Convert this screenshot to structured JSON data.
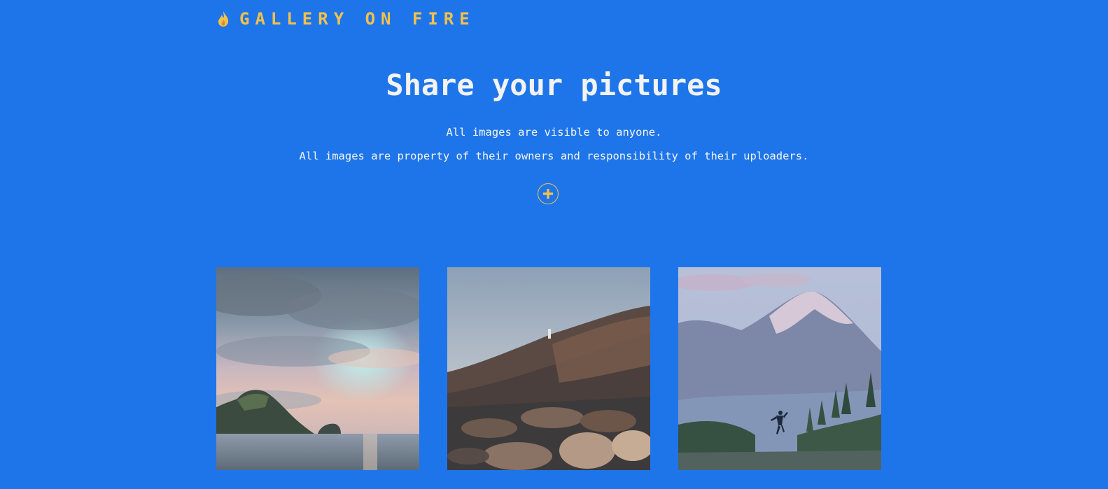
{
  "header": {
    "brand_icon": "flame-icon",
    "brand_name": "GALLERY ON FIRE"
  },
  "hero": {
    "title": "Share your pictures",
    "line1": "All images are visible to anyone.",
    "line2": "All images are property of their owners and responsibility of their uploaders."
  },
  "upload": {
    "icon": "plus-icon"
  },
  "colors": {
    "background": "#1e75ea",
    "accent": "#f2c14b",
    "text": "#f3f3f3"
  },
  "gallery": {
    "photos": [
      "sea-sunset-islands-photo",
      "rocky-coast-lighthouse-photo",
      "mountain-jumper-photo"
    ]
  }
}
